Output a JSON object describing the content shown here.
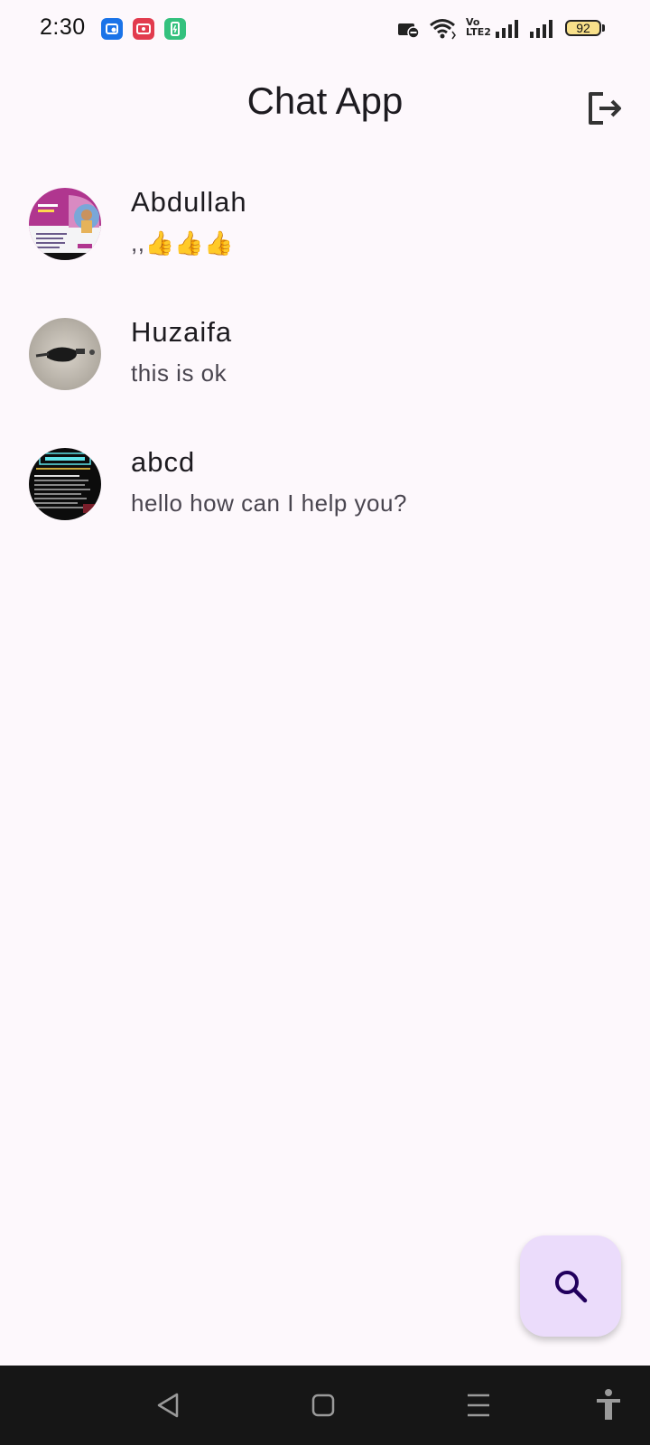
{
  "status_bar": {
    "time": "2:30",
    "network_label": "Vo\nLTE2",
    "battery_level": "92",
    "notification_icons": [
      "notification-app-icon",
      "screen-record-icon",
      "battery-saver-icon"
    ],
    "colors": {
      "notif_blue": "#1a73e8",
      "notif_red": "#e23b4e",
      "notif_green": "#34c17e",
      "battery_fill": "#f8e08a"
    }
  },
  "app_bar": {
    "title": "Chat App",
    "logout_icon": "logout-icon"
  },
  "chats": [
    {
      "name": "Abdullah",
      "last_message": ",,👍👍👍"
    },
    {
      "name": "Huzaifa",
      "last_message": "this is ok"
    },
    {
      "name": "abcd",
      "last_message": "hello how can I help you?"
    }
  ],
  "fab": {
    "icon": "search-icon",
    "background": "#ebdcfb",
    "icon_color": "#21005d"
  },
  "nav_bar": {
    "buttons": [
      "back-icon",
      "home-icon",
      "recents-icon",
      "accessibility-icon"
    ]
  },
  "theme": {
    "background": "#fdf8fc",
    "text": "#1d1b20",
    "subtext": "#49454f"
  }
}
